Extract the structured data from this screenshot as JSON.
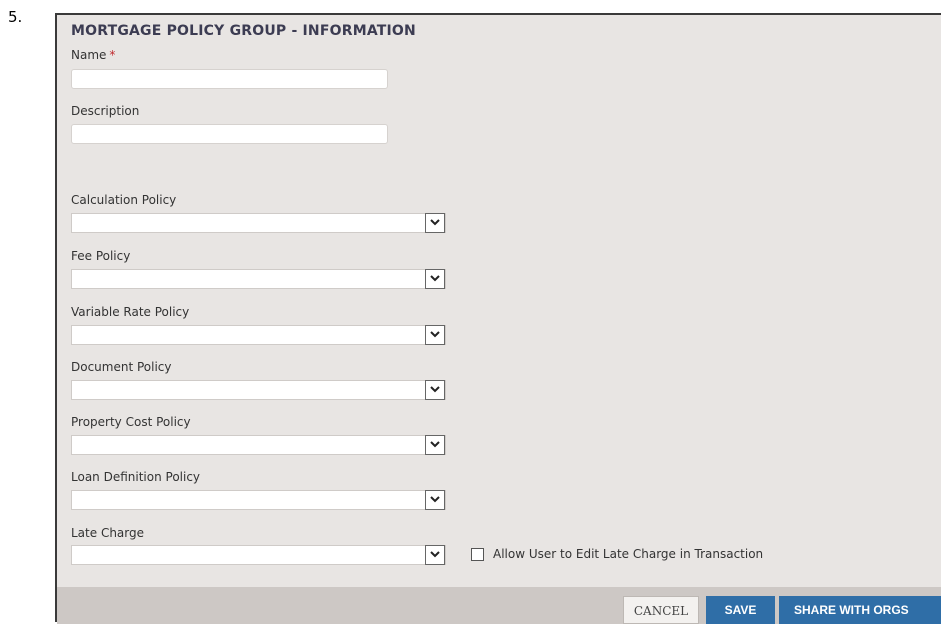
{
  "step_number": "5.",
  "form": {
    "title": "MORTGAGE POLICY GROUP - INFORMATION",
    "name": {
      "label": "Name",
      "required_mark": "*",
      "value": ""
    },
    "description": {
      "label": "Description",
      "value": ""
    },
    "calculation_policy": {
      "label": "Calculation Policy",
      "value": ""
    },
    "fee_policy": {
      "label": "Fee Policy",
      "value": ""
    },
    "variable_rate_policy": {
      "label": "Variable Rate Policy",
      "value": ""
    },
    "document_policy": {
      "label": "Document Policy",
      "value": ""
    },
    "property_cost_policy": {
      "label": "Property Cost Policy",
      "value": ""
    },
    "loan_definition_policy": {
      "label": "Loan Definition Policy",
      "value": ""
    },
    "late_charge": {
      "label": "Late Charge",
      "value": ""
    },
    "allow_edit_late_charge": {
      "label": "Allow User to Edit Late Charge in Transaction",
      "checked": false
    }
  },
  "footer": {
    "cancel_label": "CANCEL",
    "save_label": "SAVE",
    "share_label": "SHARE WITH ORGS"
  },
  "icons": {
    "dropdown": "chevron-down-icon",
    "checkbox": "checkbox-icon"
  },
  "colors": {
    "panel_bg": "#e8e5e3",
    "title": "#3c3c52",
    "required": "#c0282d",
    "primary_button": "#2f6ea7",
    "footer_bar": "#cdc8c5"
  }
}
